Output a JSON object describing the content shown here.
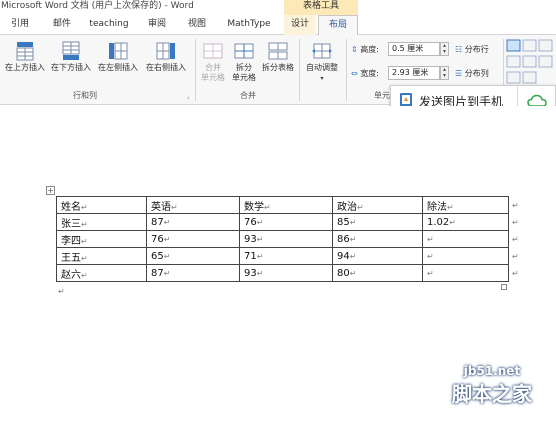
{
  "window": {
    "title": "Microsoft Word 文档 (用户上次保存的) - Word",
    "contextual_group": "表格工具"
  },
  "tabs": [
    {
      "label": "引用"
    },
    {
      "label": "邮件"
    },
    {
      "label": "teaching"
    },
    {
      "label": "审阅"
    },
    {
      "label": "视图"
    },
    {
      "label": "MathType"
    },
    {
      "label": "设计"
    },
    {
      "label": "布局"
    }
  ],
  "ribbon": {
    "rows_cols": {
      "group_label": "行和列",
      "insert_above": "在上方插入",
      "insert_below": "在下方插入",
      "insert_left": "在左侧插入",
      "insert_right": "在右侧插入"
    },
    "merge": {
      "group_label": "合并",
      "merge_cells_1": "合并",
      "merge_cells_2": "单元格",
      "split_cells_1": "拆分",
      "split_cells_2": "单元格",
      "split_table": "拆分表格"
    },
    "cell_size": {
      "group_label": "单元",
      "autofit": "自动调整",
      "height_label": "高度:",
      "height_value": "0.5 厘米",
      "width_label": "宽度:",
      "width_value": "2.93 厘米",
      "distribute_rows": "分布行",
      "distribute_cols": "分布列"
    }
  },
  "popup": {
    "text": "发送图片到手机"
  },
  "table": {
    "header": [
      "姓名",
      "英语",
      "数学",
      "政治",
      "除法"
    ],
    "rows": [
      [
        "张三",
        "87",
        "76",
        "85",
        "1.02"
      ],
      [
        "李四",
        "76",
        "93",
        "86",
        ""
      ],
      [
        "王五",
        "65",
        "71",
        "94",
        ""
      ],
      [
        "赵六",
        "87",
        "93",
        "80",
        ""
      ]
    ],
    "cell_mark": "↵"
  },
  "watermark": {
    "line1": "jb51.net",
    "line2": "脚本之家"
  },
  "colors": {
    "accent": "#2b579a",
    "contextual_tab_bg": "#fdf3db",
    "ribbon_bg": "#f7f7f7"
  }
}
